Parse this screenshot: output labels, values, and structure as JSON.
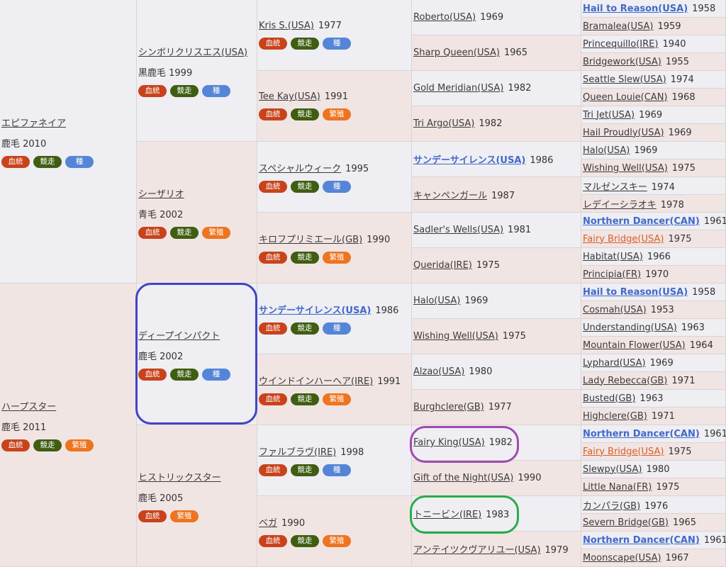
{
  "badges": {
    "blood": "血統",
    "race": "競走",
    "seed": "種",
    "breed": "繁殖"
  },
  "gen1": [
    {
      "name": "エピファネイア",
      "sub": "鹿毛 2010",
      "badges": [
        "blood",
        "race",
        "seed"
      ]
    },
    {
      "name": "ハープスター",
      "sub": "鹿毛 2011",
      "badges": [
        "blood",
        "race",
        "breed"
      ]
    }
  ],
  "gen2": [
    {
      "name": "シンボリクリスエス(USA)",
      "sub": "黒鹿毛 1999",
      "badges": [
        "blood",
        "race",
        "seed"
      ]
    },
    {
      "name": "シーザリオ",
      "sub": "青毛 2002",
      "badges": [
        "blood",
        "race",
        "breed"
      ]
    },
    {
      "name": "ディープインパクト",
      "sub": "鹿毛 2002",
      "badges": [
        "blood",
        "race",
        "seed"
      ]
    },
    {
      "name": "ヒストリックスター",
      "sub": "鹿毛 2005",
      "badges": [
        "blood",
        "breed"
      ]
    }
  ],
  "gen3": [
    {
      "name": "Kris S.(USA)",
      "year": "1977",
      "badges": [
        "blood",
        "race",
        "seed"
      ]
    },
    {
      "name": "Tee Kay(USA)",
      "year": "1991",
      "badges": [
        "blood",
        "race",
        "breed"
      ]
    },
    {
      "name": "スペシャルウィーク",
      "year": "1995",
      "badges": [
        "blood",
        "race",
        "seed"
      ]
    },
    {
      "name": "キロフプリミエール(GB)",
      "year": "1990",
      "badges": [
        "blood",
        "race",
        "breed"
      ]
    },
    {
      "name": "サンデーサイレンス(USA)",
      "year": "1986",
      "badges": [
        "blood",
        "race",
        "seed"
      ],
      "bold": true
    },
    {
      "name": "ウインドインハーヘア(IRE)",
      "year": "1991",
      "badges": [
        "blood",
        "race",
        "breed"
      ]
    },
    {
      "name": "ファルブラヴ(IRE)",
      "year": "1998",
      "badges": [
        "blood",
        "race",
        "seed"
      ]
    },
    {
      "name": "ベガ",
      "year": "1990",
      "badges": [
        "blood",
        "race",
        "breed"
      ]
    }
  ],
  "gen4": [
    {
      "name": "Roberto(USA)",
      "year": "1969"
    },
    {
      "name": "Sharp Queen(USA)",
      "year": "1965"
    },
    {
      "name": "Gold Meridian(USA)",
      "year": "1982"
    },
    {
      "name": "Tri Argo(USA)",
      "year": "1982"
    },
    {
      "name": "サンデーサイレンス(USA)",
      "year": "1986",
      "bold": true
    },
    {
      "name": "キャンペンガール",
      "year": "1987"
    },
    {
      "name": "Sadler's Wells(USA)",
      "year": "1981"
    },
    {
      "name": "Querida(IRE)",
      "year": "1975"
    },
    {
      "name": "Halo(USA)",
      "year": "1969"
    },
    {
      "name": "Wishing Well(USA)",
      "year": "1975"
    },
    {
      "name": "Alzao(USA)",
      "year": "1980"
    },
    {
      "name": "Burghclere(GB)",
      "year": "1977"
    },
    {
      "name": "Fairy King(USA)",
      "year": "1982"
    },
    {
      "name": "Gift of the Night(USA)",
      "year": "1990"
    },
    {
      "name": "トニービン(IRE)",
      "year": "1983"
    },
    {
      "name": "アンテイツクヴアリユー(USA)",
      "year": "1979"
    }
  ],
  "gen5": [
    {
      "name": "Hail to Reason(USA)",
      "year": "1958",
      "bold": true
    },
    {
      "name": "Bramalea(USA)",
      "year": "1959"
    },
    {
      "name": "Princequillo(IRE)",
      "year": "1940"
    },
    {
      "name": "Bridgework(USA)",
      "year": "1955"
    },
    {
      "name": "Seattle Slew(USA)",
      "year": "1974"
    },
    {
      "name": "Queen Louie(CAN)",
      "year": "1968"
    },
    {
      "name": "Tri Jet(USA)",
      "year": "1969"
    },
    {
      "name": "Hail Proudly(USA)",
      "year": "1969"
    },
    {
      "name": "Halo(USA)",
      "year": "1969"
    },
    {
      "name": "Wishing Well(USA)",
      "year": "1975"
    },
    {
      "name": "マルゼンスキー",
      "year": "1974"
    },
    {
      "name": "レデイーシラオキ",
      "year": "1978"
    },
    {
      "name": "Northern Dancer(CAN)",
      "year": "1961",
      "bold": true
    },
    {
      "name": "Fairy Bridge(USA)",
      "year": "1975",
      "orange": true
    },
    {
      "name": "Habitat(USA)",
      "year": "1966"
    },
    {
      "name": "Principia(FR)",
      "year": "1970"
    },
    {
      "name": "Hail to Reason(USA)",
      "year": "1958",
      "bold": true
    },
    {
      "name": "Cosmah(USA)",
      "year": "1953"
    },
    {
      "name": "Understanding(USA)",
      "year": "1963"
    },
    {
      "name": "Mountain Flower(USA)",
      "year": "1964"
    },
    {
      "name": "Lyphard(USA)",
      "year": "1969"
    },
    {
      "name": "Lady Rebecca(GB)",
      "year": "1971"
    },
    {
      "name": "Busted(GB)",
      "year": "1963"
    },
    {
      "name": "Highclere(GB)",
      "year": "1971"
    },
    {
      "name": "Northern Dancer(CAN)",
      "year": "1961",
      "bold": true
    },
    {
      "name": "Fairy Bridge(USA)",
      "year": "1975",
      "orange": true
    },
    {
      "name": "Slewpy(USA)",
      "year": "1980"
    },
    {
      "name": "Little Nana(FR)",
      "year": "1975"
    },
    {
      "name": "カンパラ(GB)",
      "year": "1976"
    },
    {
      "name": "Severn Bridge(GB)",
      "year": "1965"
    },
    {
      "name": "Northern Dancer(CAN)",
      "year": "1961",
      "bold": true
    },
    {
      "name": "Moonscape(USA)",
      "year": "1967"
    }
  ],
  "highlights": [
    {
      "target": "ディープインパクト",
      "color": "#3f45c4"
    },
    {
      "target": "Fairy King(USA)",
      "color": "#a24ab0"
    },
    {
      "target": "トニービン(IRE)",
      "color": "#26ad4a"
    }
  ]
}
